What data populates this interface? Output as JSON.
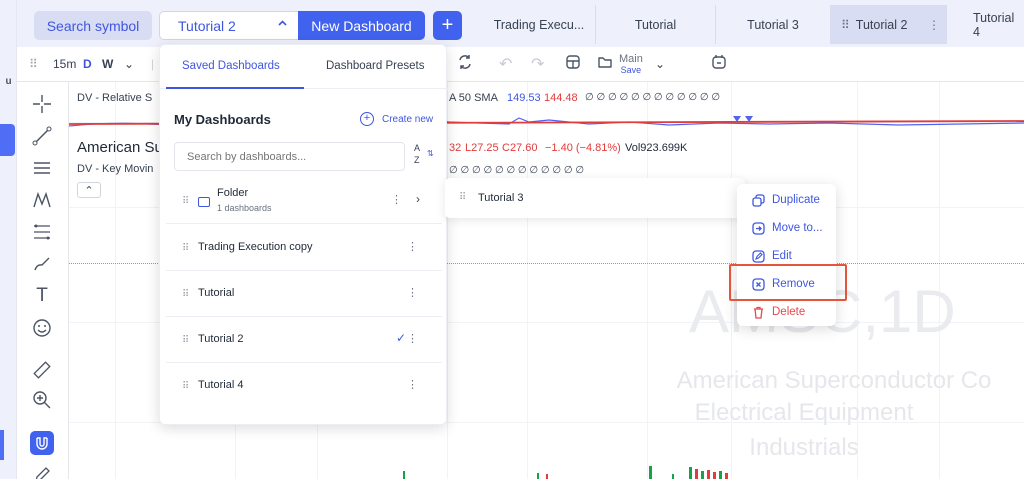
{
  "topbar": {
    "search_label": "Search symbol",
    "selected_dashboard": "Tutorial 2",
    "new_dashboard_label": "New Dashboard",
    "add_label": "+",
    "tabs": [
      {
        "label": "Trading Execu..."
      },
      {
        "label": "Tutorial"
      },
      {
        "label": "Tutorial 3"
      },
      {
        "label": "Tutorial 2"
      },
      {
        "label": "Tutorial 4"
      }
    ]
  },
  "toolbar": {
    "interval_15m": "15m",
    "interval_d": "D",
    "interval_w": "W",
    "main_label": "Main",
    "save_label": "Save"
  },
  "left_strip": {
    "label": "u"
  },
  "chart": {
    "ind_rs_left": "DV - Relative S",
    "ind_rs_right": "A 50 SMA",
    "rs_val1": "149.53",
    "rs_val2": "144.48",
    "rs_nulls": "∅ ∅ ∅ ∅ ∅ ∅ ∅ ∅ ∅ ∅ ∅ ∅",
    "symbol_name": "American Su",
    "ohlc_l_tail": "32",
    "ohlc_l": "L27.25",
    "ohlc_c": "C27.60",
    "ohlc_change": "−1.40 (−4.81%)",
    "ohlc_vol": "Vol923.699K",
    "ind_km": "DV - Key Movin",
    "km_nulls": "∅ ∅ ∅ ∅ ∅ ∅ ∅ ∅ ∅ ∅ ∅ ∅",
    "collapse_glyph": "⌃",
    "watermark_ticker": "AMSC,1D",
    "watermark_company": "American Superconductor Co",
    "watermark_industry": "Electrical Equipment",
    "watermark_sector": "Industrials"
  },
  "dropdown": {
    "tab_saved": "Saved Dashboards",
    "tab_presets": "Dashboard Presets",
    "section_title": "My Dashboards",
    "create_new": "Create new",
    "search_placeholder": "Search by dashboards...",
    "sort_a": "A",
    "sort_z": "Z",
    "folder": {
      "name": "Folder",
      "sub": "1 dashboards"
    },
    "items": [
      {
        "name": "Trading Execution copy"
      },
      {
        "name": "Tutorial"
      },
      {
        "name": "Tutorial 2"
      },
      {
        "name": "Tutorial 4"
      }
    ]
  },
  "submenu": {
    "label": "Tutorial 3"
  },
  "context_menu": {
    "duplicate": "Duplicate",
    "move_to": "Move to...",
    "edit": "Edit",
    "remove": "Remove",
    "delete": "Delete"
  },
  "colors": {
    "accent": "#4062ee",
    "danger": "#e5484d",
    "highlight": "#e5553b"
  }
}
